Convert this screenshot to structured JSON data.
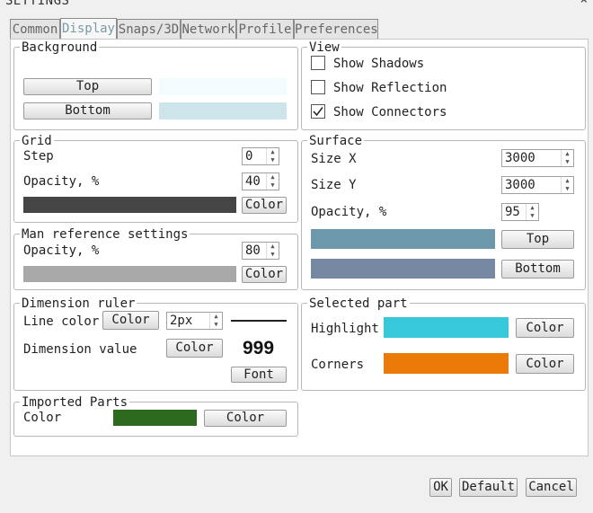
{
  "window": {
    "title": "SETTINGS",
    "close": "×"
  },
  "tabs": [
    "Common",
    "Display",
    "Snaps/3D",
    "Network",
    "Profile",
    "Preferences"
  ],
  "active_tab": "Display",
  "background": {
    "title": "Background",
    "top_label": "Top",
    "bottom_label": "Bottom",
    "top_color": "#f2fbfd",
    "bottom_color": "#cde4ea"
  },
  "view": {
    "title": "View",
    "items": [
      {
        "label": "Show Shadows",
        "checked": false
      },
      {
        "label": "Show Reflection",
        "checked": false
      },
      {
        "label": "Show Connectors",
        "checked": true
      }
    ]
  },
  "grid": {
    "title": "Grid",
    "step_label": "Step",
    "step_value": "0",
    "opacity_label": "Opacity, %",
    "opacity_value": "40",
    "color": "#454545",
    "color_button": "Color"
  },
  "man_reference": {
    "title": "Man reference settings",
    "opacity_label": "Opacity, %",
    "opacity_value": "80",
    "color": "#a8a8a8",
    "color_button": "Color"
  },
  "surface": {
    "title": "Surface",
    "size_x_label": "Size X",
    "size_x_value": "3000",
    "size_y_label": "Size Y",
    "size_y_value": "3000",
    "opacity_label": "Opacity, %",
    "opacity_value": "95",
    "top_color": "#6b98ab",
    "bottom_color": "#7788a3",
    "top_button": "Top",
    "bottom_button": "Bottom"
  },
  "dimension_ruler": {
    "title": "Dimension ruler",
    "line_color_label": "Line color",
    "line_color_button": "Color",
    "line_width_value": "2px",
    "dimension_value_label": "Dimension value",
    "dimension_color_button": "Color",
    "sample_value": "999",
    "font_button": "Font"
  },
  "selected_part": {
    "title": "Selected part",
    "highlight_label": "Highlight",
    "highlight_color": "#38c8dc",
    "highlight_button": "Color",
    "corners_label": "Corners",
    "corners_color": "#ec7a08",
    "corners_button": "Color"
  },
  "imported_parts": {
    "title": "Imported Parts",
    "color_label": "Color",
    "color": "#2e6a1e",
    "color_button": "Color"
  },
  "footer": {
    "ok": "OK",
    "default": "Default",
    "cancel": "Cancel"
  }
}
